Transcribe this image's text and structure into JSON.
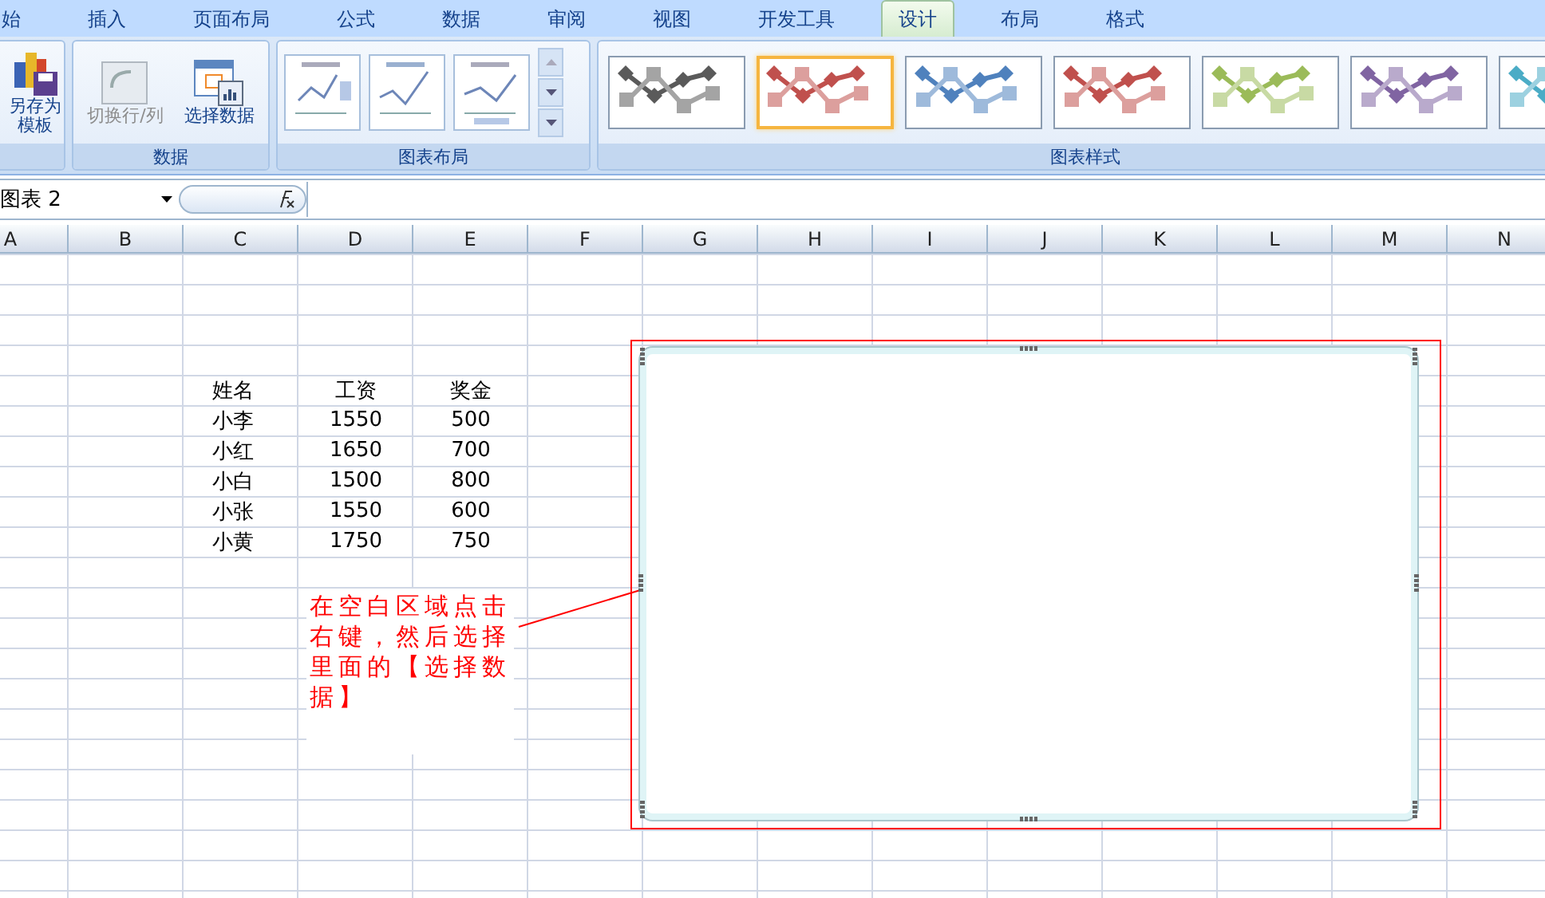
{
  "tabs": [
    {
      "label": "始",
      "selected": false
    },
    {
      "label": "插入",
      "selected": false
    },
    {
      "label": "页面布局",
      "selected": false
    },
    {
      "label": "公式",
      "selected": false
    },
    {
      "label": "数据",
      "selected": false
    },
    {
      "label": "审阅",
      "selected": false
    },
    {
      "label": "视图",
      "selected": false
    },
    {
      "label": "开发工具",
      "selected": false
    },
    {
      "label": "设计",
      "selected": true
    },
    {
      "label": "布局",
      "selected": false
    },
    {
      "label": "格式",
      "selected": false
    }
  ],
  "ribbon": {
    "save_template": {
      "label": "另存为模板"
    },
    "data_group": {
      "label": "数据",
      "buttons": [
        {
          "label": "切换行/列",
          "disabled": true,
          "kind": "switch"
        },
        {
          "label": "选择数据",
          "disabled": false,
          "kind": "select"
        }
      ]
    },
    "layout_group": {
      "label": "图表布局"
    },
    "style_group": {
      "label": "图表样式",
      "styles": [
        {
          "color": "#5a5a5a",
          "selected": false
        },
        {
          "color": "#c0504d",
          "selected": true
        },
        {
          "color": "#4f81bd",
          "selected": false
        },
        {
          "color": "#c0504d",
          "selected": false
        },
        {
          "color": "#9bbb59",
          "selected": false
        },
        {
          "color": "#8064a2",
          "selected": false
        },
        {
          "color": "#4bacc6",
          "selected": false
        }
      ]
    }
  },
  "name_box": "图表 2",
  "columns": [
    "A",
    "B",
    "C",
    "D",
    "E",
    "F",
    "G",
    "H",
    "I",
    "J",
    "K",
    "L",
    "M",
    "N"
  ],
  "table": {
    "header": [
      "姓名",
      "工资",
      "奖金"
    ],
    "rows": [
      [
        "小李",
        "1550",
        "500"
      ],
      [
        "小红",
        "1650",
        "700"
      ],
      [
        "小白",
        "1500",
        "800"
      ],
      [
        "小张",
        "1550",
        "600"
      ],
      [
        "小黄",
        "1750",
        "750"
      ]
    ]
  },
  "annotation": "在空白区域点击右键，然后选择里面的【选择数据】"
}
